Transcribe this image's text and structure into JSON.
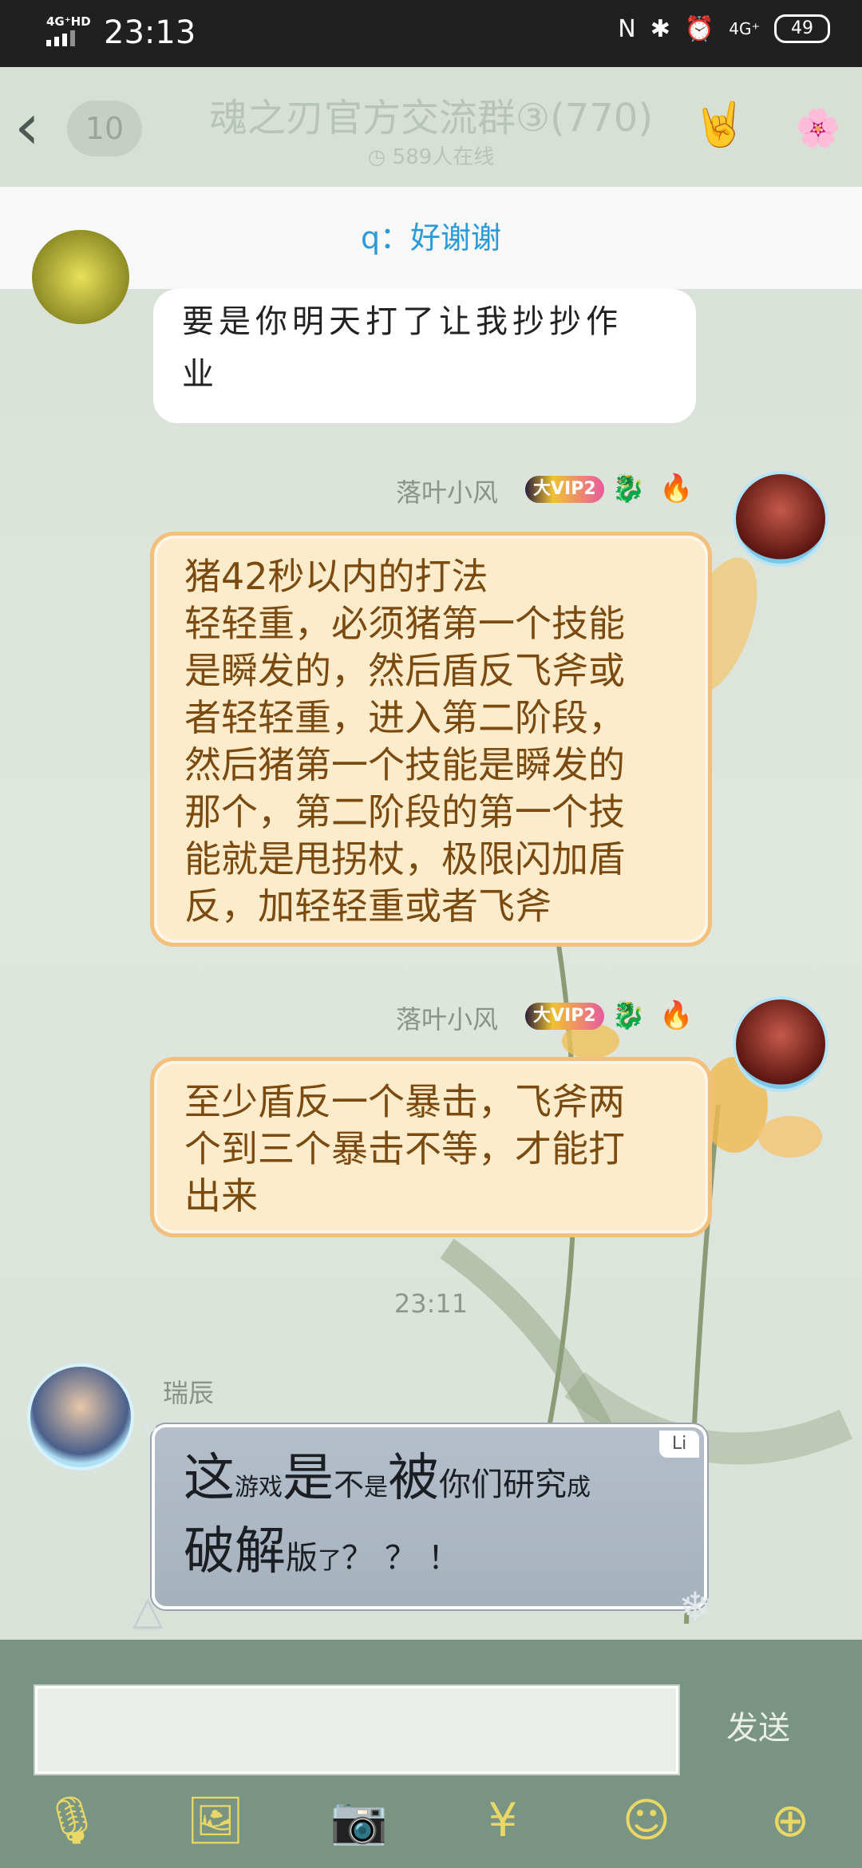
{
  "statusbar": {
    "network": "4G⁺HD",
    "time": "23:13",
    "right_net": "4G⁺",
    "battery": "49"
  },
  "header": {
    "back_icon": "chevron-left",
    "unread_count": "10",
    "group_title": "魂之刃官方交流群③(770)",
    "online_text": "589人在线",
    "hand_icon": "rock-hand-icon",
    "group_avatar": "flower-group-avatar"
  },
  "notice": {
    "text": "q：好谢谢"
  },
  "messages": [
    {
      "type": "white",
      "lines": [
        "要是你明天打了让我抄抄作",
        "业"
      ]
    },
    {
      "type": "cream",
      "sender": "落叶小风",
      "vip": "大VIP2",
      "lines": [
        "猪42秒以内的打法",
        "轻轻重，必须猪第一个技能",
        "是瞬发的，然后盾反飞斧或",
        "者轻轻重，进入第二阶段，",
        "然后猪第一个技能是瞬发的",
        "那个，第二阶段的第一个技",
        "能就是甩拐杖，极限闪加盾",
        "反，加轻轻重或者飞斧"
      ]
    },
    {
      "type": "cream",
      "sender": "落叶小风",
      "vip": "大VIP2",
      "lines": [
        "至少盾反一个暴击，飞斧两",
        "个到三个暴击不等，才能打",
        "出来"
      ]
    },
    {
      "type": "timestamp",
      "text": "23:11"
    },
    {
      "type": "gray",
      "sender": "瑞辰",
      "corner_tag": "Li",
      "line1": [
        [
          "这",
          "big"
        ],
        [
          "游戏",
          "small"
        ],
        [
          "是",
          "big"
        ],
        [
          "不",
          "mid"
        ],
        [
          "是",
          "small"
        ],
        [
          "被",
          "big"
        ],
        [
          "你们研究",
          "mid"
        ],
        [
          "成",
          "small"
        ]
      ],
      "line2": [
        [
          "破解",
          "big"
        ],
        [
          "版",
          "mid"
        ],
        [
          "了",
          "small"
        ],
        [
          "？？！",
          "mid"
        ]
      ]
    }
  ],
  "input": {
    "send_label": "发送"
  },
  "toolbar": [
    "mic-icon",
    "image-icon",
    "camera-icon",
    "red-packet-icon",
    "emoji-icon",
    "plus-icon"
  ]
}
